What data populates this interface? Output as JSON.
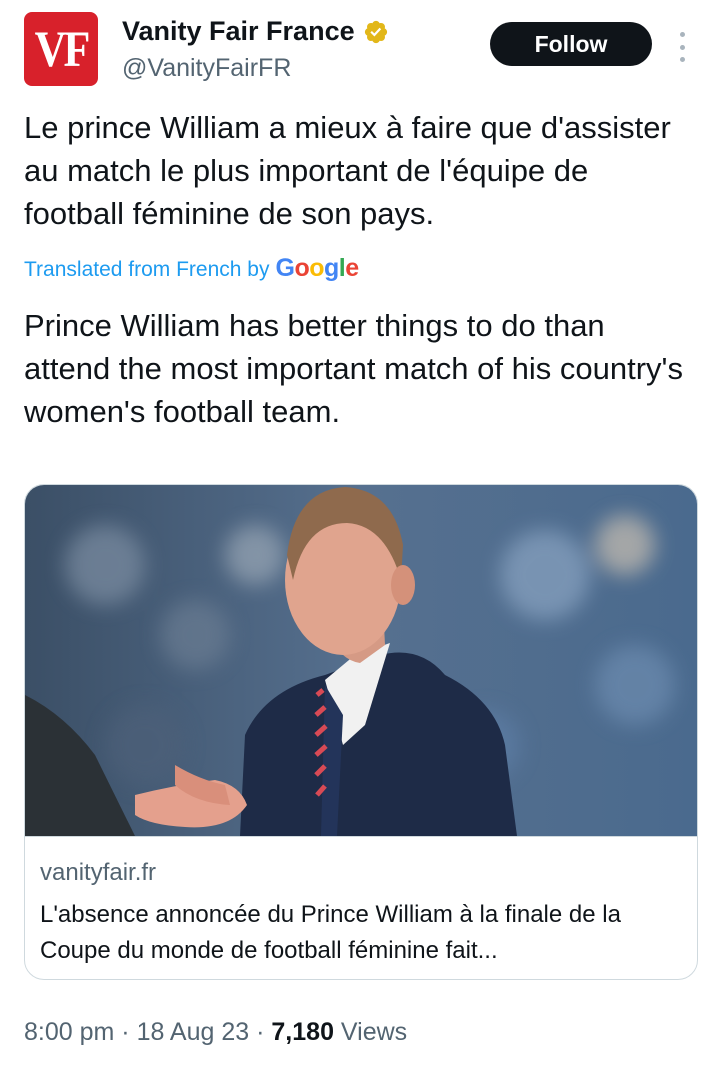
{
  "account": {
    "avatar_text": "VF",
    "display_name": "Vanity Fair France",
    "handle": "@VanityFairFR",
    "verified": true,
    "verified_badge_color": "#e2b719",
    "avatar_color": "#d8212b"
  },
  "actions": {
    "follow_label": "Follow",
    "more_icon": "more-vertical-icon"
  },
  "tweet": {
    "original_text": "Le prince William a mieux à faire que d'assister au match le plus important de l'équipe de football féminine de son pays.",
    "translated_note": "Translated from French by",
    "translation_provider": "Google",
    "translated_text": "Prince William has better things to do than attend the most important match of his country's women's football team."
  },
  "link_card": {
    "domain": "vanityfair.fr",
    "title": "L'absence annoncée du Prince William à la finale de la Coupe du monde de football féminine fait..."
  },
  "meta": {
    "time": "8:00 pm",
    "sep1": " · ",
    "date": "18 Aug 23",
    "sep2": " · ",
    "views_count": "7,180",
    "views_label": " Views"
  },
  "colors": {
    "link_blue": "#1d9bf0",
    "text_primary": "#0f1419",
    "text_secondary": "#536471"
  }
}
